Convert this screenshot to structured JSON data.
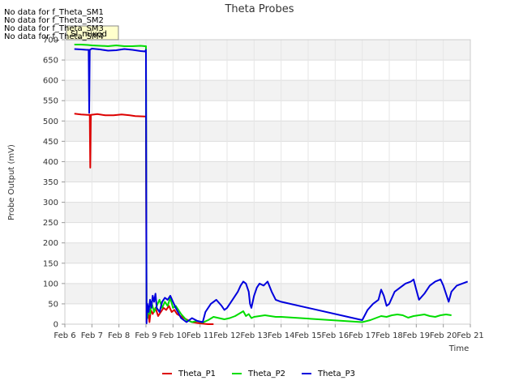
{
  "chart_data": {
    "type": "line",
    "title": "Theta Probes",
    "xlabel": "Time",
    "ylabel": "Probe Output (mV)",
    "xlim": [
      6,
      21
    ],
    "ylim": [
      0,
      700
    ],
    "grid": true,
    "legend_position": "bottom",
    "x_ticks": [
      {
        "v": 6,
        "label": "Feb 6"
      },
      {
        "v": 7,
        "label": "Feb 7"
      },
      {
        "v": 8,
        "label": "Feb 8"
      },
      {
        "v": 9,
        "label": "Feb 9"
      },
      {
        "v": 10,
        "label": "Feb 10"
      },
      {
        "v": 11,
        "label": "Feb 11"
      },
      {
        "v": 12,
        "label": "Feb 12"
      },
      {
        "v": 13,
        "label": "Feb 13"
      },
      {
        "v": 14,
        "label": "Feb 14"
      },
      {
        "v": 15,
        "label": "Feb 15"
      },
      {
        "v": 16,
        "label": "Feb 16"
      },
      {
        "v": 17,
        "label": "Feb 17"
      },
      {
        "v": 18,
        "label": "Feb 18"
      },
      {
        "v": 19,
        "label": "Feb 19"
      },
      {
        "v": 20,
        "label": "Feb 20"
      },
      {
        "v": 21,
        "label": "Feb 21"
      }
    ],
    "y_ticks": [
      0,
      50,
      100,
      150,
      200,
      250,
      300,
      350,
      400,
      450,
      500,
      550,
      600,
      650,
      700
    ],
    "notes": [
      "No data for f_Theta_SM1",
      "No data for f_Theta_SM2",
      "No data for f_Theta_SM3",
      "No data for f_Theta_SM4"
    ],
    "annotation": "SI_mixed",
    "series": [
      {
        "name": "Theta_P1",
        "color": "#dd0000",
        "points": [
          [
            6.35,
            518
          ],
          [
            6.6,
            516
          ],
          [
            6.85,
            515
          ],
          [
            6.92,
            515
          ],
          [
            6.94,
            385
          ],
          [
            6.96,
            515
          ],
          [
            7.2,
            517
          ],
          [
            7.5,
            514
          ],
          [
            7.8,
            514
          ],
          [
            8.1,
            516
          ],
          [
            8.4,
            514
          ],
          [
            8.6,
            512
          ],
          [
            8.97,
            511
          ],
          [
            9.0,
            511
          ],
          [
            9.02,
            5
          ],
          [
            9.05,
            40
          ],
          [
            9.1,
            20
          ],
          [
            9.13,
            5
          ],
          [
            9.18,
            35
          ],
          [
            9.25,
            25
          ],
          [
            9.35,
            40
          ],
          [
            9.45,
            20
          ],
          [
            9.55,
            30
          ],
          [
            9.65,
            40
          ],
          [
            9.75,
            35
          ],
          [
            9.85,
            45
          ],
          [
            9.95,
            30
          ],
          [
            10.05,
            35
          ],
          [
            10.15,
            25
          ],
          [
            10.4,
            15
          ],
          [
            10.7,
            5
          ],
          [
            11.0,
            2
          ],
          [
            11.3,
            0
          ],
          [
            11.5,
            0
          ]
        ]
      },
      {
        "name": "Theta_P2",
        "color": "#00dd00",
        "points": [
          [
            6.35,
            688
          ],
          [
            6.6,
            688
          ],
          [
            6.85,
            687
          ],
          [
            7.0,
            686
          ],
          [
            7.3,
            685
          ],
          [
            7.6,
            684
          ],
          [
            7.9,
            686
          ],
          [
            8.2,
            684
          ],
          [
            8.5,
            684
          ],
          [
            8.8,
            685
          ],
          [
            8.97,
            684
          ],
          [
            9.0,
            684
          ],
          [
            9.02,
            50
          ],
          [
            9.05,
            15
          ],
          [
            9.1,
            40
          ],
          [
            9.15,
            25
          ],
          [
            9.2,
            55
          ],
          [
            9.3,
            30
          ],
          [
            9.4,
            45
          ],
          [
            9.5,
            60
          ],
          [
            9.6,
            40
          ],
          [
            9.7,
            55
          ],
          [
            9.8,
            45
          ],
          [
            9.9,
            65
          ],
          [
            10.0,
            40
          ],
          [
            10.1,
            45
          ],
          [
            10.3,
            25
          ],
          [
            10.5,
            10
          ],
          [
            10.7,
            5
          ],
          [
            10.9,
            8
          ],
          [
            11.1,
            4
          ],
          [
            11.3,
            10
          ],
          [
            11.5,
            18
          ],
          [
            11.7,
            15
          ],
          [
            11.9,
            12
          ],
          [
            12.1,
            15
          ],
          [
            12.3,
            20
          ],
          [
            12.5,
            28
          ],
          [
            12.6,
            32
          ],
          [
            12.7,
            20
          ],
          [
            12.8,
            25
          ],
          [
            12.9,
            15
          ],
          [
            13.0,
            18
          ],
          [
            13.2,
            20
          ],
          [
            13.4,
            22
          ],
          [
            13.6,
            20
          ],
          [
            13.8,
            18
          ],
          [
            14.0,
            18
          ],
          [
            17.0,
            5
          ],
          [
            17.3,
            10
          ],
          [
            17.5,
            15
          ],
          [
            17.7,
            20
          ],
          [
            17.9,
            18
          ],
          [
            18.1,
            22
          ],
          [
            18.3,
            24
          ],
          [
            18.5,
            22
          ],
          [
            18.7,
            16
          ],
          [
            18.9,
            20
          ],
          [
            19.1,
            22
          ],
          [
            19.3,
            24
          ],
          [
            19.5,
            20
          ],
          [
            19.7,
            18
          ],
          [
            19.9,
            22
          ],
          [
            20.1,
            24
          ],
          [
            20.3,
            22
          ]
        ]
      },
      {
        "name": "Theta_P3",
        "color": "#0000dd",
        "points": [
          [
            6.35,
            677
          ],
          [
            6.6,
            676
          ],
          [
            6.8,
            675
          ],
          [
            6.88,
            675
          ],
          [
            6.9,
            520
          ],
          [
            6.92,
            675
          ],
          [
            7.0,
            678
          ],
          [
            7.3,
            676
          ],
          [
            7.6,
            673
          ],
          [
            7.9,
            674
          ],
          [
            8.2,
            677
          ],
          [
            8.5,
            675
          ],
          [
            8.8,
            672
          ],
          [
            8.97,
            671
          ],
          [
            9.0,
            675
          ],
          [
            9.02,
            2
          ],
          [
            9.05,
            50
          ],
          [
            9.1,
            30
          ],
          [
            9.15,
            60
          ],
          [
            9.2,
            40
          ],
          [
            9.25,
            70
          ],
          [
            9.3,
            55
          ],
          [
            9.35,
            75
          ],
          [
            9.4,
            40
          ],
          [
            9.5,
            30
          ],
          [
            9.6,
            55
          ],
          [
            9.7,
            65
          ],
          [
            9.8,
            60
          ],
          [
            9.9,
            70
          ],
          [
            10.0,
            55
          ],
          [
            10.1,
            40
          ],
          [
            10.3,
            15
          ],
          [
            10.5,
            5
          ],
          [
            10.7,
            15
          ],
          [
            10.9,
            8
          ],
          [
            11.1,
            5
          ],
          [
            11.2,
            30
          ],
          [
            11.4,
            50
          ],
          [
            11.6,
            60
          ],
          [
            11.8,
            45
          ],
          [
            11.9,
            35
          ],
          [
            12.0,
            40
          ],
          [
            12.2,
            60
          ],
          [
            12.4,
            80
          ],
          [
            12.5,
            95
          ],
          [
            12.6,
            105
          ],
          [
            12.7,
            100
          ],
          [
            12.8,
            80
          ],
          [
            12.85,
            50
          ],
          [
            12.9,
            40
          ],
          [
            13.0,
            70
          ],
          [
            13.1,
            90
          ],
          [
            13.2,
            100
          ],
          [
            13.35,
            95
          ],
          [
            13.5,
            105
          ],
          [
            13.65,
            80
          ],
          [
            13.8,
            60
          ],
          [
            14.0,
            55
          ],
          [
            17.0,
            10
          ],
          [
            17.2,
            35
          ],
          [
            17.4,
            50
          ],
          [
            17.6,
            60
          ],
          [
            17.7,
            85
          ],
          [
            17.8,
            70
          ],
          [
            17.9,
            45
          ],
          [
            18.0,
            50
          ],
          [
            18.2,
            80
          ],
          [
            18.4,
            90
          ],
          [
            18.6,
            100
          ],
          [
            18.8,
            105
          ],
          [
            18.9,
            110
          ],
          [
            19.0,
            85
          ],
          [
            19.1,
            60
          ],
          [
            19.3,
            75
          ],
          [
            19.5,
            95
          ],
          [
            19.7,
            105
          ],
          [
            19.9,
            110
          ],
          [
            20.0,
            95
          ],
          [
            20.1,
            75
          ],
          [
            20.2,
            55
          ],
          [
            20.3,
            80
          ],
          [
            20.5,
            95
          ],
          [
            20.7,
            100
          ],
          [
            20.9,
            105
          ]
        ]
      }
    ]
  }
}
